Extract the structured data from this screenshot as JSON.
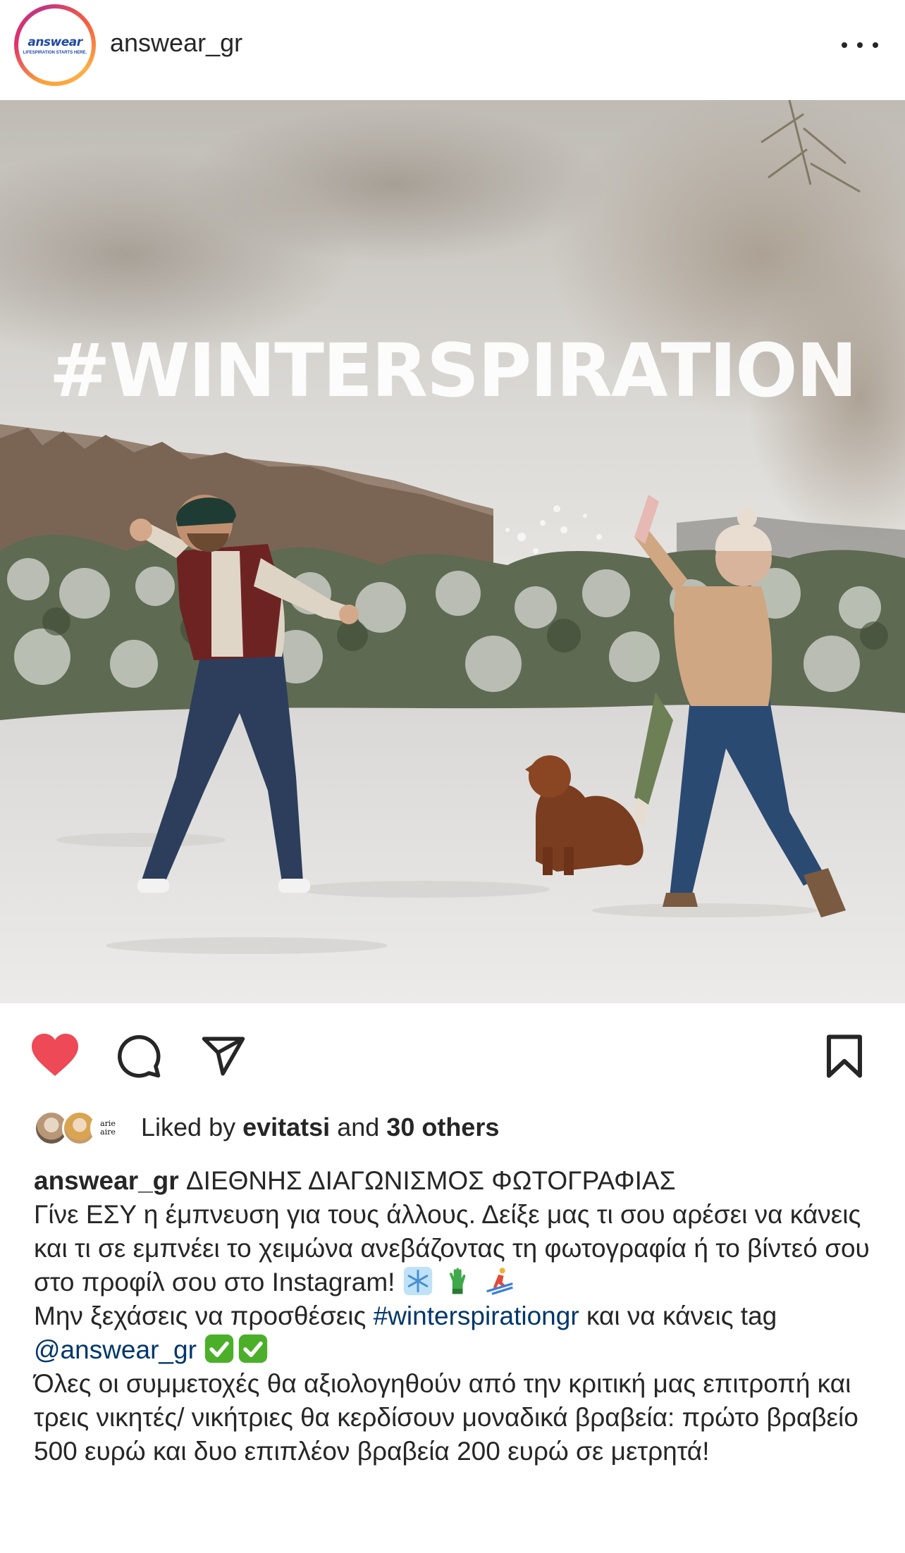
{
  "post": {
    "username": "answear_gr",
    "avatar": {
      "logo_word": "answear",
      "logo_tagline": "LIFESPIRATION STARTS HERE."
    },
    "image": {
      "overlay_text": "#WINTERSPIRATION"
    },
    "likes": {
      "prefix": "Liked by",
      "user": "evitatsi",
      "connector": "and",
      "others": "30 others",
      "mini_avatar_label": "arie aire"
    },
    "caption": {
      "username": "answear_gr",
      "title": "ΔΙΕΘΝΗΣ ΔΙΑΓΩΝΙΣΜΟΣ ΦΩΤΟΓΡΑΦΙΑΣ",
      "line1": "Γίνε ΕΣΥ η έμπνευση για τους άλλους. Δείξε μας τι σου αρέσει να κάνεις και τι σε εμπνέει το χειμώνα ανεβάζοντας τη φωτογραφία ή το βίντεό σου στο προφίλ σου στο Instagram!",
      "line2_prefix": "Μην ξεχάσεις να προσθέσεις",
      "hashtag": "#winterspirationgr",
      "line2_middle": "και να κάνεις tag",
      "mention": "@answear_gr",
      "line3": "Όλες οι συμμετοχές θα αξιολογηθούν από την κριτική μας επιτροπή και τρεις νικητές/ νικήτριες θα κερδίσουν μοναδικά βραβεία: πρώτο βραβείο 500 ευρώ και δυο επιπλέον βραβεία 200 ευρώ σε μετρητά!"
    }
  },
  "icons": {
    "like": "heart-icon",
    "comment": "comment-icon",
    "share": "send-icon",
    "save": "bookmark-icon",
    "more": "more-icon",
    "emoji_snowflake": "snowflake-icon",
    "emoji_glove": "glove-icon",
    "emoji_skier": "skier-icon",
    "emoji_check": "check-mark-icon"
  },
  "colors": {
    "heart": "#ed4956",
    "link": "#00376b",
    "text": "#262626",
    "check_bg": "#4caf2a"
  }
}
